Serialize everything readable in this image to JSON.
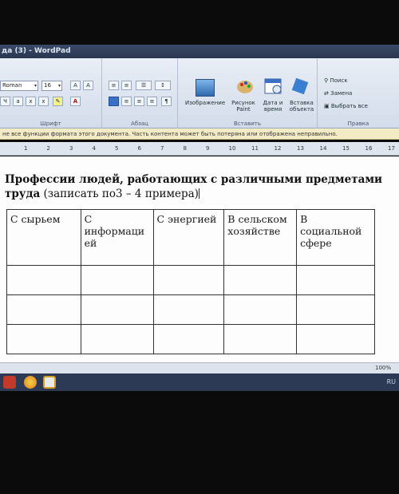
{
  "window": {
    "title": "да (3) - WordPad"
  },
  "ribbon": {
    "font": {
      "name": "Roman",
      "size": "16",
      "group_label": "Шрифт"
    },
    "paragraph": {
      "group_label": "Абзац"
    },
    "insert": {
      "group_label": "Вставить",
      "picture_label": "Изображение",
      "paint_label": "Рисунок Paint",
      "datetime_label": "Дата и время",
      "object_label": "Вставка объекта"
    },
    "edit": {
      "group_label": "Правка",
      "find_label": "Поиск",
      "replace_label": "Замена",
      "select_all_label": "Выбрать все"
    }
  },
  "infobar": {
    "message": "не все функции формата этого документа. Часть контента может быть потеряна или отображена неправильно."
  },
  "ruler": {
    "ticks": [
      "1",
      "2",
      "3",
      "4",
      "5",
      "6",
      "7",
      "8",
      "9",
      "10",
      "11",
      "12",
      "13",
      "14",
      "15",
      "16",
      "17"
    ]
  },
  "document": {
    "heading_bold": "Профессии людей, работающих с различными предметами труда",
    "heading_normal": " (записать по3 – 4 примера)",
    "table": {
      "headers": [
        "С сырьем",
        "С информаци ей",
        "С энергией",
        "В сельском хозяйстве",
        "В социальной сфере"
      ]
    }
  },
  "status": {
    "zoom": "100%",
    "language": "RU"
  }
}
